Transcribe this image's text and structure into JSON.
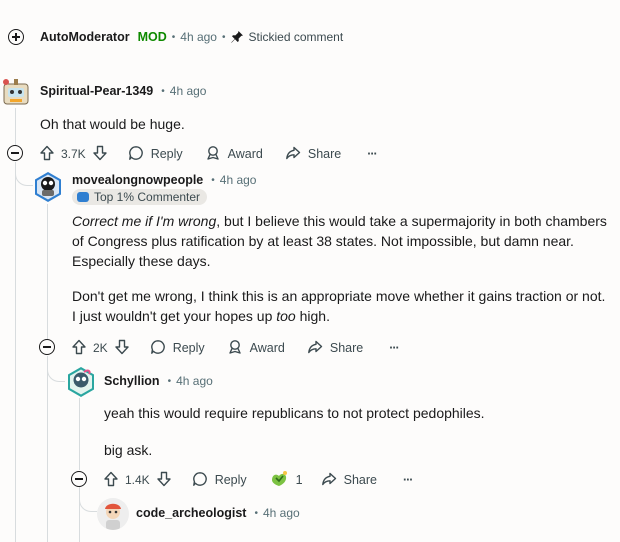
{
  "automod": {
    "username": "AutoModerator",
    "badge": "MOD",
    "time": "4h ago",
    "stickied": "Stickied comment"
  },
  "c1": {
    "username": "Spiritual-Pear-1349",
    "time": "4h ago",
    "body": "Oh that would be huge.",
    "votes": "3.7K",
    "reply": "Reply",
    "award": "Award",
    "share": "Share",
    "more": "···"
  },
  "c2": {
    "username": "movealongnowpeople",
    "time": "4h ago",
    "flair": "Top 1% Commenter",
    "p1_italic": "Correct me if I'm wrong",
    "p1_rest": ", but I believe this would take a supermajority in both chambers of Congress plus ratification by at least 38 states. Not impossible, but damn near. Especially these days.",
    "p2_start": "Don't get me wrong, I think this is an appropriate move whether it gains traction or not. I just wouldn't get your hopes up ",
    "p2_italic": "too",
    "p2_end": " high.",
    "votes": "2K",
    "reply": "Reply",
    "award": "Award",
    "share": "Share",
    "more": "···"
  },
  "c3": {
    "username": "Schyllion",
    "time": "4h ago",
    "p1": "yeah this would require republicans to not protect pedophiles.",
    "p2": "big ask.",
    "votes": "1.4K",
    "reply": "Reply",
    "award_count": "1",
    "share": "Share",
    "more": "···"
  },
  "c4": {
    "username": "code_archeologist",
    "time": "4h ago"
  },
  "icons": [
    "plus-circle-icon",
    "pin-icon",
    "minus-circle-icon",
    "upvote-icon",
    "downvote-icon",
    "reply-bubble-icon",
    "award-icon",
    "share-icon",
    "more-icon",
    "helpful-award-icon"
  ],
  "colors": {
    "mod_green": "#0e8a00",
    "meta_gray": "#576f76",
    "thread_line": "#d8dcde",
    "text": "#1a1a1b"
  }
}
